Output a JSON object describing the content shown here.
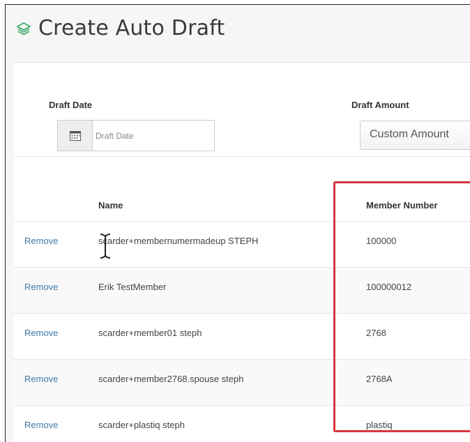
{
  "page": {
    "title": "Create Auto Draft",
    "title_icon": "layers-icon",
    "accent_color": "#3fa96b",
    "highlight_color": "#d9363e"
  },
  "form": {
    "draft_date": {
      "label": "Draft Date",
      "placeholder": "Draft Date",
      "value": "",
      "icon": "calendar-icon"
    },
    "draft_amount": {
      "label": "Draft Amount",
      "selected": "Custom Amount"
    }
  },
  "table": {
    "columns": [
      "",
      "Name",
      "Member Number"
    ],
    "rows": [
      {
        "action": "Remove",
        "name": "scarder+membernumermadeup STEPH",
        "member_number": "100000"
      },
      {
        "action": "Remove",
        "name": "Erik TestMember",
        "member_number": "100000012"
      },
      {
        "action": "Remove",
        "name": "scarder+member01 steph",
        "member_number": "2768"
      },
      {
        "action": "Remove",
        "name": "scarder+member2768.spouse steph",
        "member_number": "2768A"
      },
      {
        "action": "Remove",
        "name": "scarder+plastiq steph",
        "member_number": "plastiq"
      }
    ]
  }
}
